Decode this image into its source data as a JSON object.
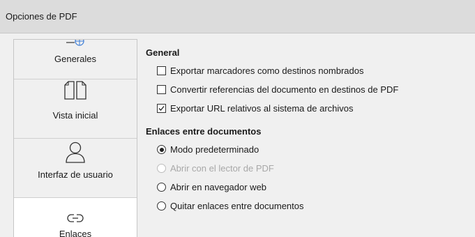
{
  "window": {
    "title": "Opciones de PDF"
  },
  "sidebar": {
    "items": [
      {
        "label": "Generales",
        "icon": "globe-icon",
        "active": false
      },
      {
        "label": "Vista inicial",
        "icon": "pages-icon",
        "active": false
      },
      {
        "label": "Interfaz de usuario",
        "icon": "user-icon",
        "active": false
      },
      {
        "label": "Enlaces",
        "icon": "link-icon",
        "active": true
      }
    ]
  },
  "general": {
    "title": "General",
    "options": [
      {
        "label": "Exportar marcadores como destinos nombrados",
        "checked": false
      },
      {
        "label": "Convertir referencias del documento en destinos de PDF",
        "checked": false
      },
      {
        "label": "Exportar URL relativos al sistema de archivos",
        "checked": true
      }
    ]
  },
  "cross_links": {
    "title": "Enlaces entre documentos",
    "options": [
      {
        "label": "Modo predeterminado",
        "selected": true,
        "enabled": true
      },
      {
        "label": "Abrir con el lector de PDF",
        "selected": false,
        "enabled": false
      },
      {
        "label": "Abrir en navegador web",
        "selected": false,
        "enabled": true
      },
      {
        "label": "Quitar enlaces entre documentos",
        "selected": false,
        "enabled": true
      }
    ]
  }
}
